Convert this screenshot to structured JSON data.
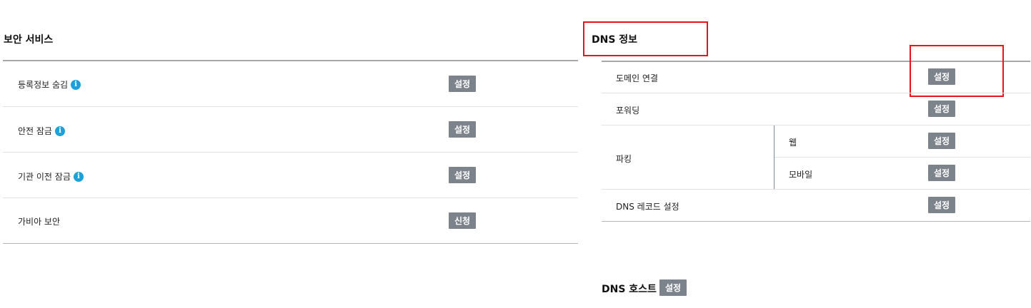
{
  "security": {
    "title": "보안 서비스",
    "items": [
      {
        "label": "등록정보 숨김",
        "button": "설정",
        "info_icon": "info-icon"
      },
      {
        "label": "안전 잠금",
        "button": "설정",
        "info_icon": "info-icon"
      },
      {
        "label": "기관 이전 잠금",
        "button": "설정",
        "info_icon": "info-icon"
      },
      {
        "label": "가비아 보안",
        "button": "신청"
      }
    ]
  },
  "dns": {
    "title": "DNS 정보",
    "domain_connect": {
      "label": "도메인 연결",
      "button": "설정"
    },
    "forwarding": {
      "label": "포워딩",
      "button": "설정"
    },
    "parking": {
      "label": "파킹",
      "web": {
        "label": "웹",
        "button": "설정"
      },
      "mobile": {
        "label": "모바일",
        "button": "설정"
      }
    },
    "dns_record": {
      "label": "DNS 레코드 설정",
      "button": "설정"
    }
  },
  "dns_host": {
    "title": "DNS 호스트",
    "button": "설정"
  },
  "colors": {
    "button_bg": "#7c838b",
    "info_icon": "#1da1db",
    "highlight": "#e8141c"
  }
}
